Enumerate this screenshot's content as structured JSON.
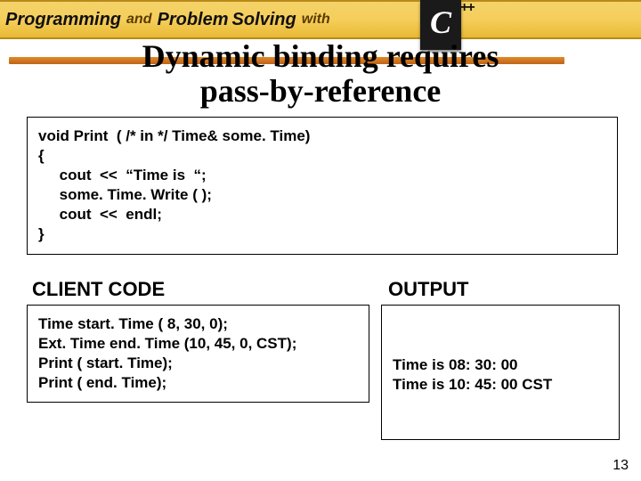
{
  "header": {
    "programming": "Programming",
    "and": "and",
    "problem": "Problem",
    "solving": "Solving",
    "with": "with",
    "logo_letter": "C",
    "logo_plus": "++"
  },
  "title_line1": "Dynamic binding requires",
  "title_line2": "pass-by-reference",
  "code_print": "void Print  ( /* in */ Time& some. Time)\n{\n     cout  <<  “Time is  “;\n     some. Time. Write ( );\n     cout  <<  endl;\n}",
  "labels": {
    "client": "CLIENT  CODE",
    "output": "OUTPUT"
  },
  "code_client": "Time start. Time ( 8, 30, 0);\nExt. Time end. Time (10, 45, 0, CST);\nPrint ( start. Time);\nPrint ( end. Time);",
  "output_text": "Time is 08: 30: 00\nTime is 10: 45: 00 CST",
  "page_number": "13"
}
